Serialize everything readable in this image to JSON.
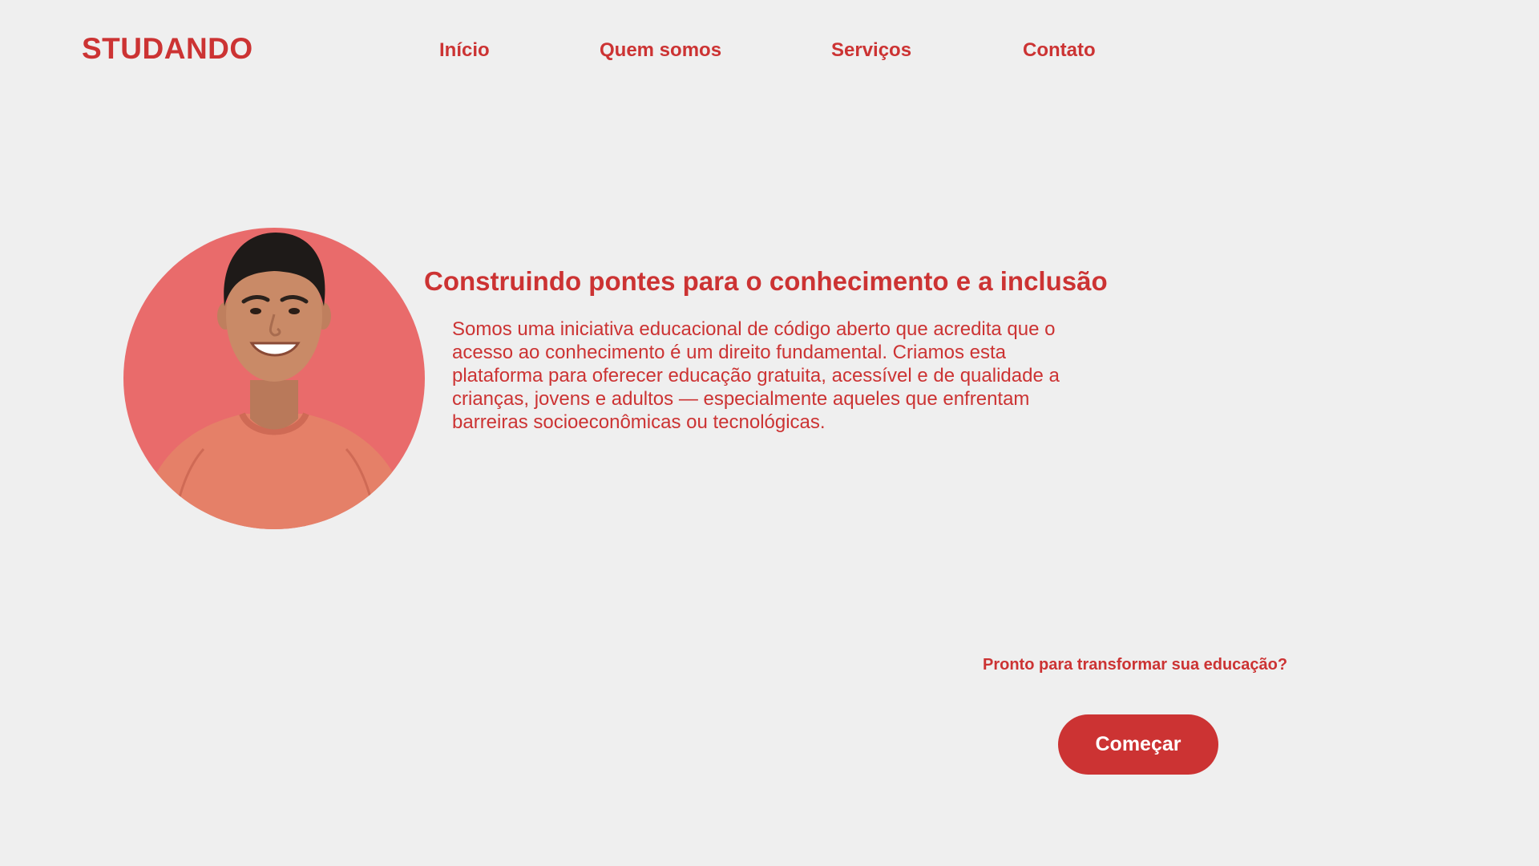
{
  "brand": {
    "name": "STUDANDO",
    "color": "#cc3333"
  },
  "nav": {
    "items": [
      {
        "label": "Início"
      },
      {
        "label": "Quem somos"
      },
      {
        "label": "Serviços"
      },
      {
        "label": "Contato"
      }
    ]
  },
  "hero": {
    "image": "smiling-young-man-portrait",
    "headline": "Construindo pontes para o conhecimento e a inclusão",
    "body": "Somos uma iniciativa educacional de código aberto que acredita que o acesso ao conhecimento é um direito fundamental. Criamos esta plataforma para oferecer educação gratuita, acessível e de qualidade a crianças, jovens e adultos — especialmente aqueles que enfrentam barreiras socioeconômicas ou tecnológicas."
  },
  "cta": {
    "prompt": "Pronto para transformar sua educação?",
    "button_label": "Começar"
  },
  "colors": {
    "background": "#efefef",
    "accent": "#cc3333",
    "avatar_bg": "#e96b6b",
    "button_text": "#ffffff"
  }
}
